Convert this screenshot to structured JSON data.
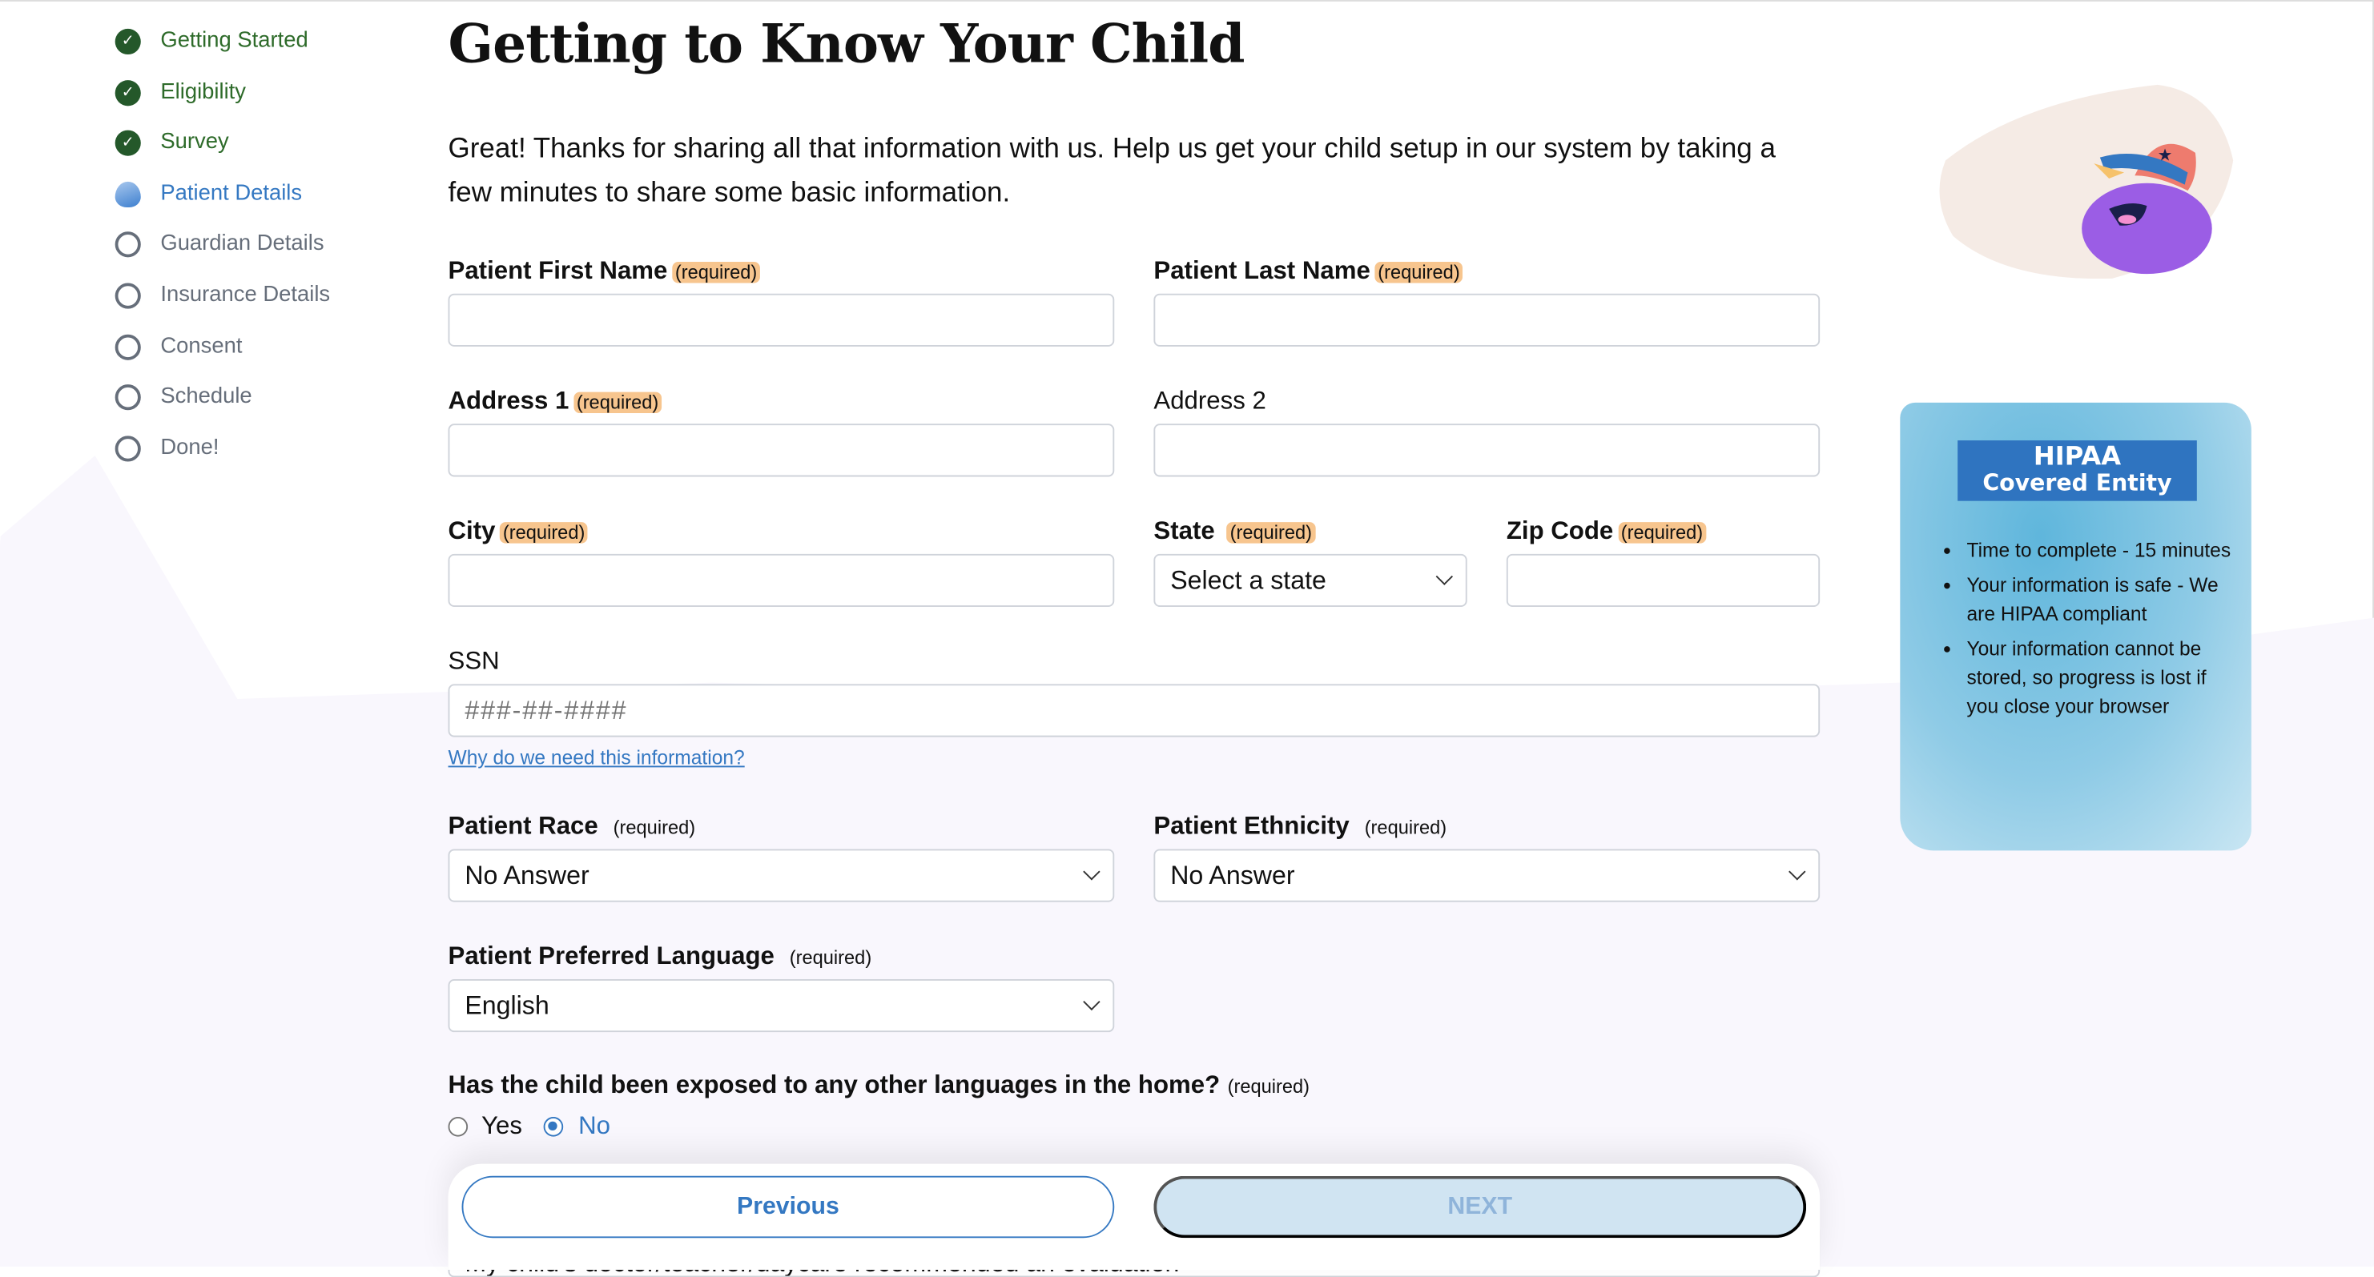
{
  "sidebar": {
    "steps": [
      {
        "label": "Getting Started",
        "status": "done"
      },
      {
        "label": "Eligibility",
        "status": "done"
      },
      {
        "label": "Survey",
        "status": "done"
      },
      {
        "label": "Patient Details",
        "status": "current"
      },
      {
        "label": "Guardian Details",
        "status": "todo"
      },
      {
        "label": "Insurance Details",
        "status": "todo"
      },
      {
        "label": "Consent",
        "status": "todo"
      },
      {
        "label": "Schedule",
        "status": "todo"
      },
      {
        "label": "Done!",
        "status": "todo"
      }
    ]
  },
  "main": {
    "title": "Getting to Know Your Child",
    "intro": "Great! Thanks for sharing all that information with us. Help us get your child setup in our system by taking a few minutes to share some basic information.",
    "required": "(required)",
    "fields": {
      "first_name": {
        "label": "Patient First Name",
        "value": ""
      },
      "last_name": {
        "label": "Patient Last Name",
        "value": ""
      },
      "address1": {
        "label": "Address 1",
        "value": ""
      },
      "address2": {
        "label": "Address 2",
        "value": ""
      },
      "city": {
        "label": "City",
        "value": ""
      },
      "state": {
        "label": "State",
        "value": "Select a state"
      },
      "zip": {
        "label": "Zip Code",
        "value": ""
      },
      "ssn": {
        "label": "SSN",
        "placeholder": "###-##-####"
      },
      "race": {
        "label": "Patient Race",
        "value": "No Answer"
      },
      "ethnicity": {
        "label": "Patient Ethnicity",
        "value": "No Answer"
      },
      "language": {
        "label": "Patient Preferred Language",
        "value": "English"
      },
      "reason": {
        "value": "My child's doctor/teacher/daycare recommended an evaluation"
      }
    },
    "ssn_link": "Why do we need this information?",
    "question": {
      "label": "Has the child been exposed to any other languages in the home?",
      "options": [
        "Yes",
        "No"
      ],
      "selected": "No"
    },
    "buttons": {
      "previous": "Previous",
      "next": "NEXT"
    }
  },
  "hipaa": {
    "title1": "HIPAA",
    "title2": "Covered Entity",
    "bullets": [
      "Time to complete - 15 minutes",
      "Your information is safe - We are HIPAA compliant",
      "Your information cannot be stored, so progress is lost if you close your browser"
    ]
  },
  "colors": {
    "accent": "#3478c2",
    "done": "#24582a",
    "required_bg": "#f7c58e",
    "next_disabled": "#d0e4f2"
  }
}
